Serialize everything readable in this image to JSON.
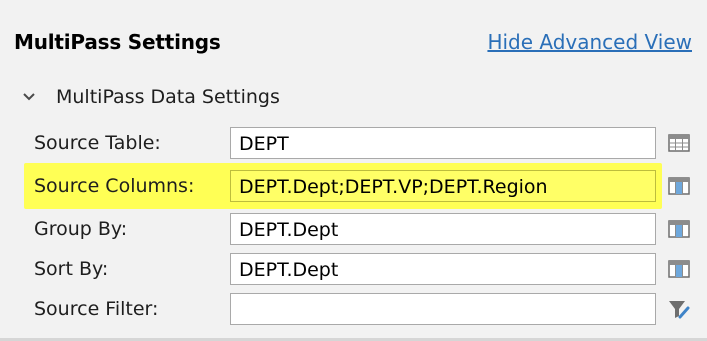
{
  "header": {
    "title": "MultiPass Settings",
    "link": "Hide Advanced View"
  },
  "section": {
    "title": "MultiPass Data Settings",
    "expanded": true
  },
  "fields": [
    {
      "label": "Source Table:",
      "value": "DEPT",
      "icon": "table-picker-icon"
    },
    {
      "label": "Source Columns:",
      "value": "DEPT.Dept;DEPT.VP;DEPT.Region",
      "icon": "column-picker-icon",
      "highlighted": true
    },
    {
      "label": "Group By:",
      "value": "DEPT.Dept",
      "icon": "column-picker-icon"
    },
    {
      "label": "Sort By:",
      "value": "DEPT.Dept",
      "icon": "column-picker-icon"
    },
    {
      "label": "Source Filter:",
      "value": "",
      "icon": "filter-edit-icon"
    }
  ],
  "colors": {
    "link": "#2a6fb8",
    "highlight": "#ffff55",
    "panel": "#f2f2f2"
  }
}
